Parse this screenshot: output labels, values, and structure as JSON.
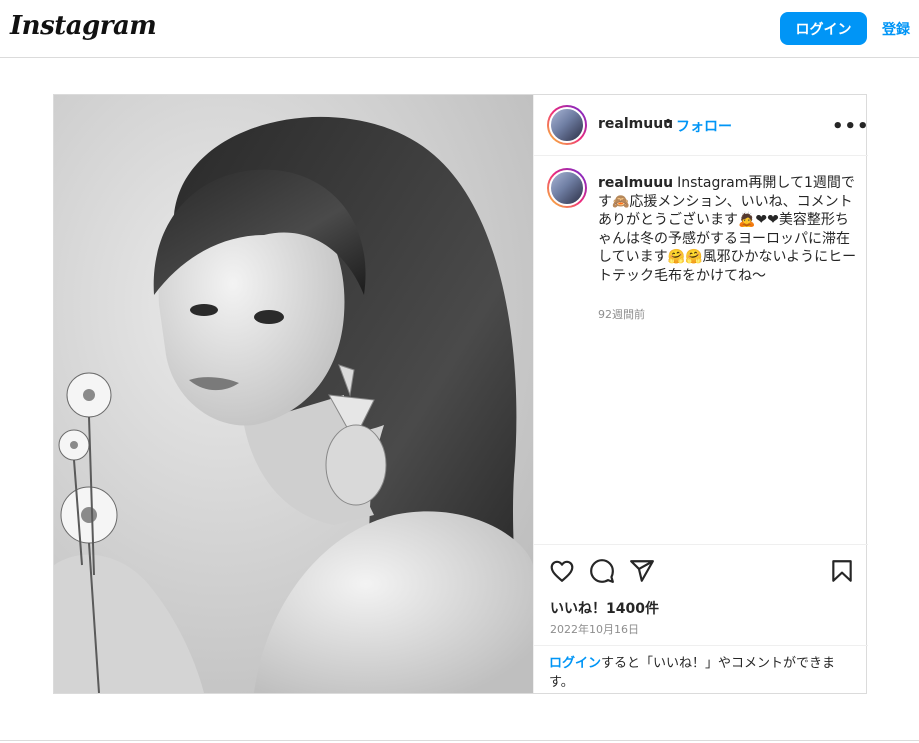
{
  "header": {
    "logo": "Instagram",
    "login_button": "ログイン",
    "signup_link": "登録"
  },
  "post": {
    "username": "realmuuu",
    "separator": "•",
    "follow": "フォロー",
    "more": "•••",
    "caption_user": "realmuuu",
    "caption_text": "Instagram再開して1週間です🙈応援メンション、いいね、コメントありがとうございます🙇❤❤美容整形ちゃんは冬の予感がするヨーロッパに滞在しています🤗🤗風邪ひかないようにヒートテック毛布をかけてね〜",
    "caption_time": "92週間前",
    "likes": "いいね！1400件",
    "date": "2022年10月16日",
    "login_prompt_link": "ログイン",
    "login_prompt_text": "すると「いいね！」やコメントができます。"
  }
}
